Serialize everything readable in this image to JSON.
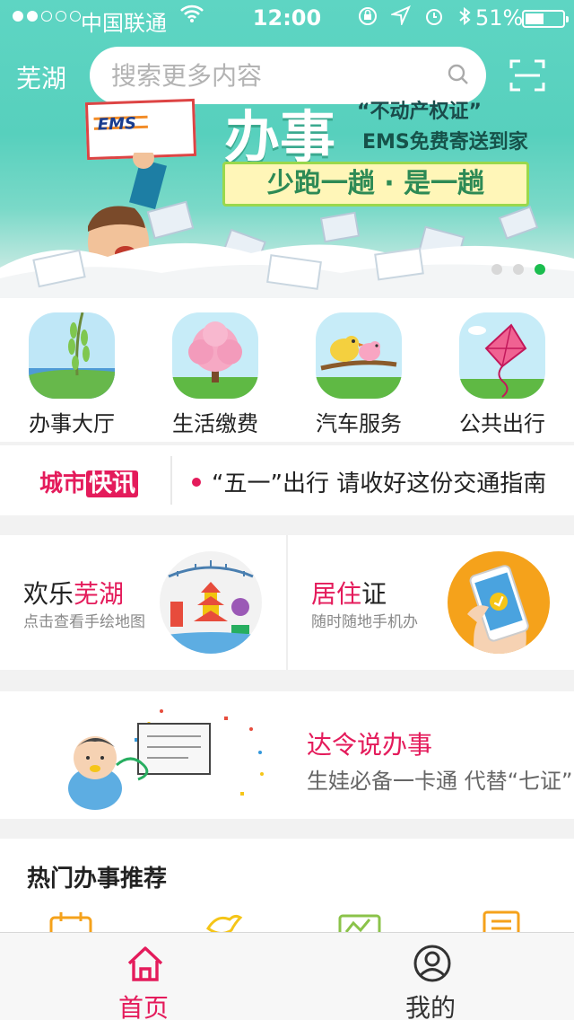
{
  "status_bar": {
    "carrier": "中国联通",
    "time": "12:00",
    "battery": "51%",
    "battery_level": 0.51
  },
  "header": {
    "city": "芜湖",
    "search_placeholder": "搜索更多内容"
  },
  "banner": {
    "logo": "EMS",
    "title": "办事",
    "subtitle_1": "“不动产权证”",
    "subtitle_2": "EMS免费寄送到家",
    "slogan": "少跑一趟 · 是一趟",
    "page_count": 3,
    "active_page": 3
  },
  "services": [
    {
      "label": "办事大厅",
      "icon": "willow-lake-icon"
    },
    {
      "label": "生活缴费",
      "icon": "blossom-tree-icon"
    },
    {
      "label": "汽车服务",
      "icon": "birds-branch-icon"
    },
    {
      "label": "公共出行",
      "icon": "kite-icon"
    }
  ],
  "news": {
    "brand_a": "城市",
    "brand_b": "快讯",
    "headline": "“五一”出行 请收好这份交通指南"
  },
  "cards": [
    {
      "title_a": "欢乐",
      "title_b": "芜湖",
      "subtitle": "点击查看手绘地图"
    },
    {
      "title_a": "居住",
      "title_b": "证",
      "subtitle": "随时随地手机办"
    }
  ],
  "promo": {
    "title": "达令说办事",
    "subtitle": "生娃必备一卡通 代替“七证”"
  },
  "hot": {
    "heading": "热门办事推荐"
  },
  "tabs": [
    {
      "label": "首页",
      "icon": "home-icon",
      "active": true
    },
    {
      "label": "我的",
      "icon": "profile-icon",
      "active": false
    }
  ],
  "colors": {
    "accent": "#e41b5b",
    "banner_teal": "#5ed5c3",
    "indicator_green": "#1bbd4f",
    "promo_orange": "#f5a21b"
  }
}
